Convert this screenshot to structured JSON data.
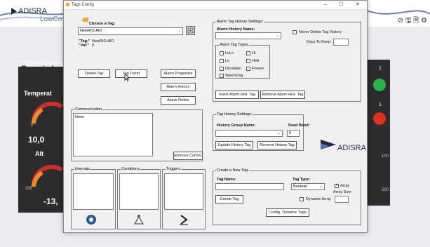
{
  "background": {
    "logo": "ADISRA",
    "logo_sub": "LowCo",
    "title": "Remote I",
    "labels": {
      "temperature": "Temperat",
      "alt": "Alt"
    },
    "values": {
      "v1": "10,0",
      "v2": "-13,"
    },
    "ticks": {
      "t0": "0",
      "t200": "200",
      "r100": "100",
      "r200": "200",
      "r1": "1",
      "r2": "1"
    },
    "right_icons": "⊘ 🖫 🗎 ⚙",
    "colors": {
      "green_led": "#2bb24c",
      "red_led": "#e0301e",
      "gauge_red": "#d22d2d",
      "gauge_orange": "#f08a2a"
    }
  },
  "window": {
    "title": "Tags Config",
    "controls": {
      "minimize": "–",
      "maximize": "☐",
      "close": "✕"
    }
  },
  "tag_select": {
    "label": "Choose a Tag:",
    "value": "NewRIO.AIO",
    "tag_line_label": "\"Tag:\"",
    "tag_line_value": "NewRIO.AIO",
    "val_line_label": "\"Val:\"",
    "val_line_value": "0"
  },
  "buttons": {
    "delete_tag": "Delete Tag",
    "tag_trend": "Tag Trend",
    "alarm_properties": "Alarm Properties",
    "alarm_history": "Alarm History",
    "alarm_online": "Alarm Online",
    "remove_comm": "Remove Comm.",
    "insert_alarm_hist": "Insert Alarm Hist. Tag",
    "remove_alarm_hist": "Remove Alarm Hist. Tag",
    "update_history": "Update History Tag",
    "remove_history": "Remove History Tag",
    "create_tag": "Create Tag",
    "config_dynamic": "Config. Dynamic Tags"
  },
  "communication": {
    "legend": "Communication",
    "value": "None"
  },
  "panels": {
    "internals": "Internals",
    "conditions": "Conditions",
    "triggers": "Triggers"
  },
  "alarm_history_settings": {
    "legend": "Alarm Tag History Settings:",
    "name_label": "Alarm History Name:",
    "name_value": "",
    "never_delete_label": "Never Delete Tag History",
    "days_label": "Days To Keep:",
    "days_value": "",
    "types_legend": "Alarm Tag Types",
    "types": [
      "LoLo",
      "Hi",
      "Lo",
      "HiHi",
      "Deviation",
      "Freeze",
      "WatchDog"
    ]
  },
  "tag_history_settings": {
    "legend": "Tag History Settings:",
    "group_label": "History Group Name:",
    "group_value": "",
    "deadband_label": "Dead Band:",
    "deadband_value": "0"
  },
  "brand": {
    "logo": "ADISRA"
  },
  "create_tag": {
    "legend": "Create a New Tag:",
    "name_label": "Tag Name:",
    "name_value": "",
    "type_label": "Tag Type:",
    "type_value": "Boolean",
    "array_label": "Array",
    "array_size_label": "Array Size:",
    "array_size_value": "",
    "dynamic_label": "Dynamic Array"
  }
}
